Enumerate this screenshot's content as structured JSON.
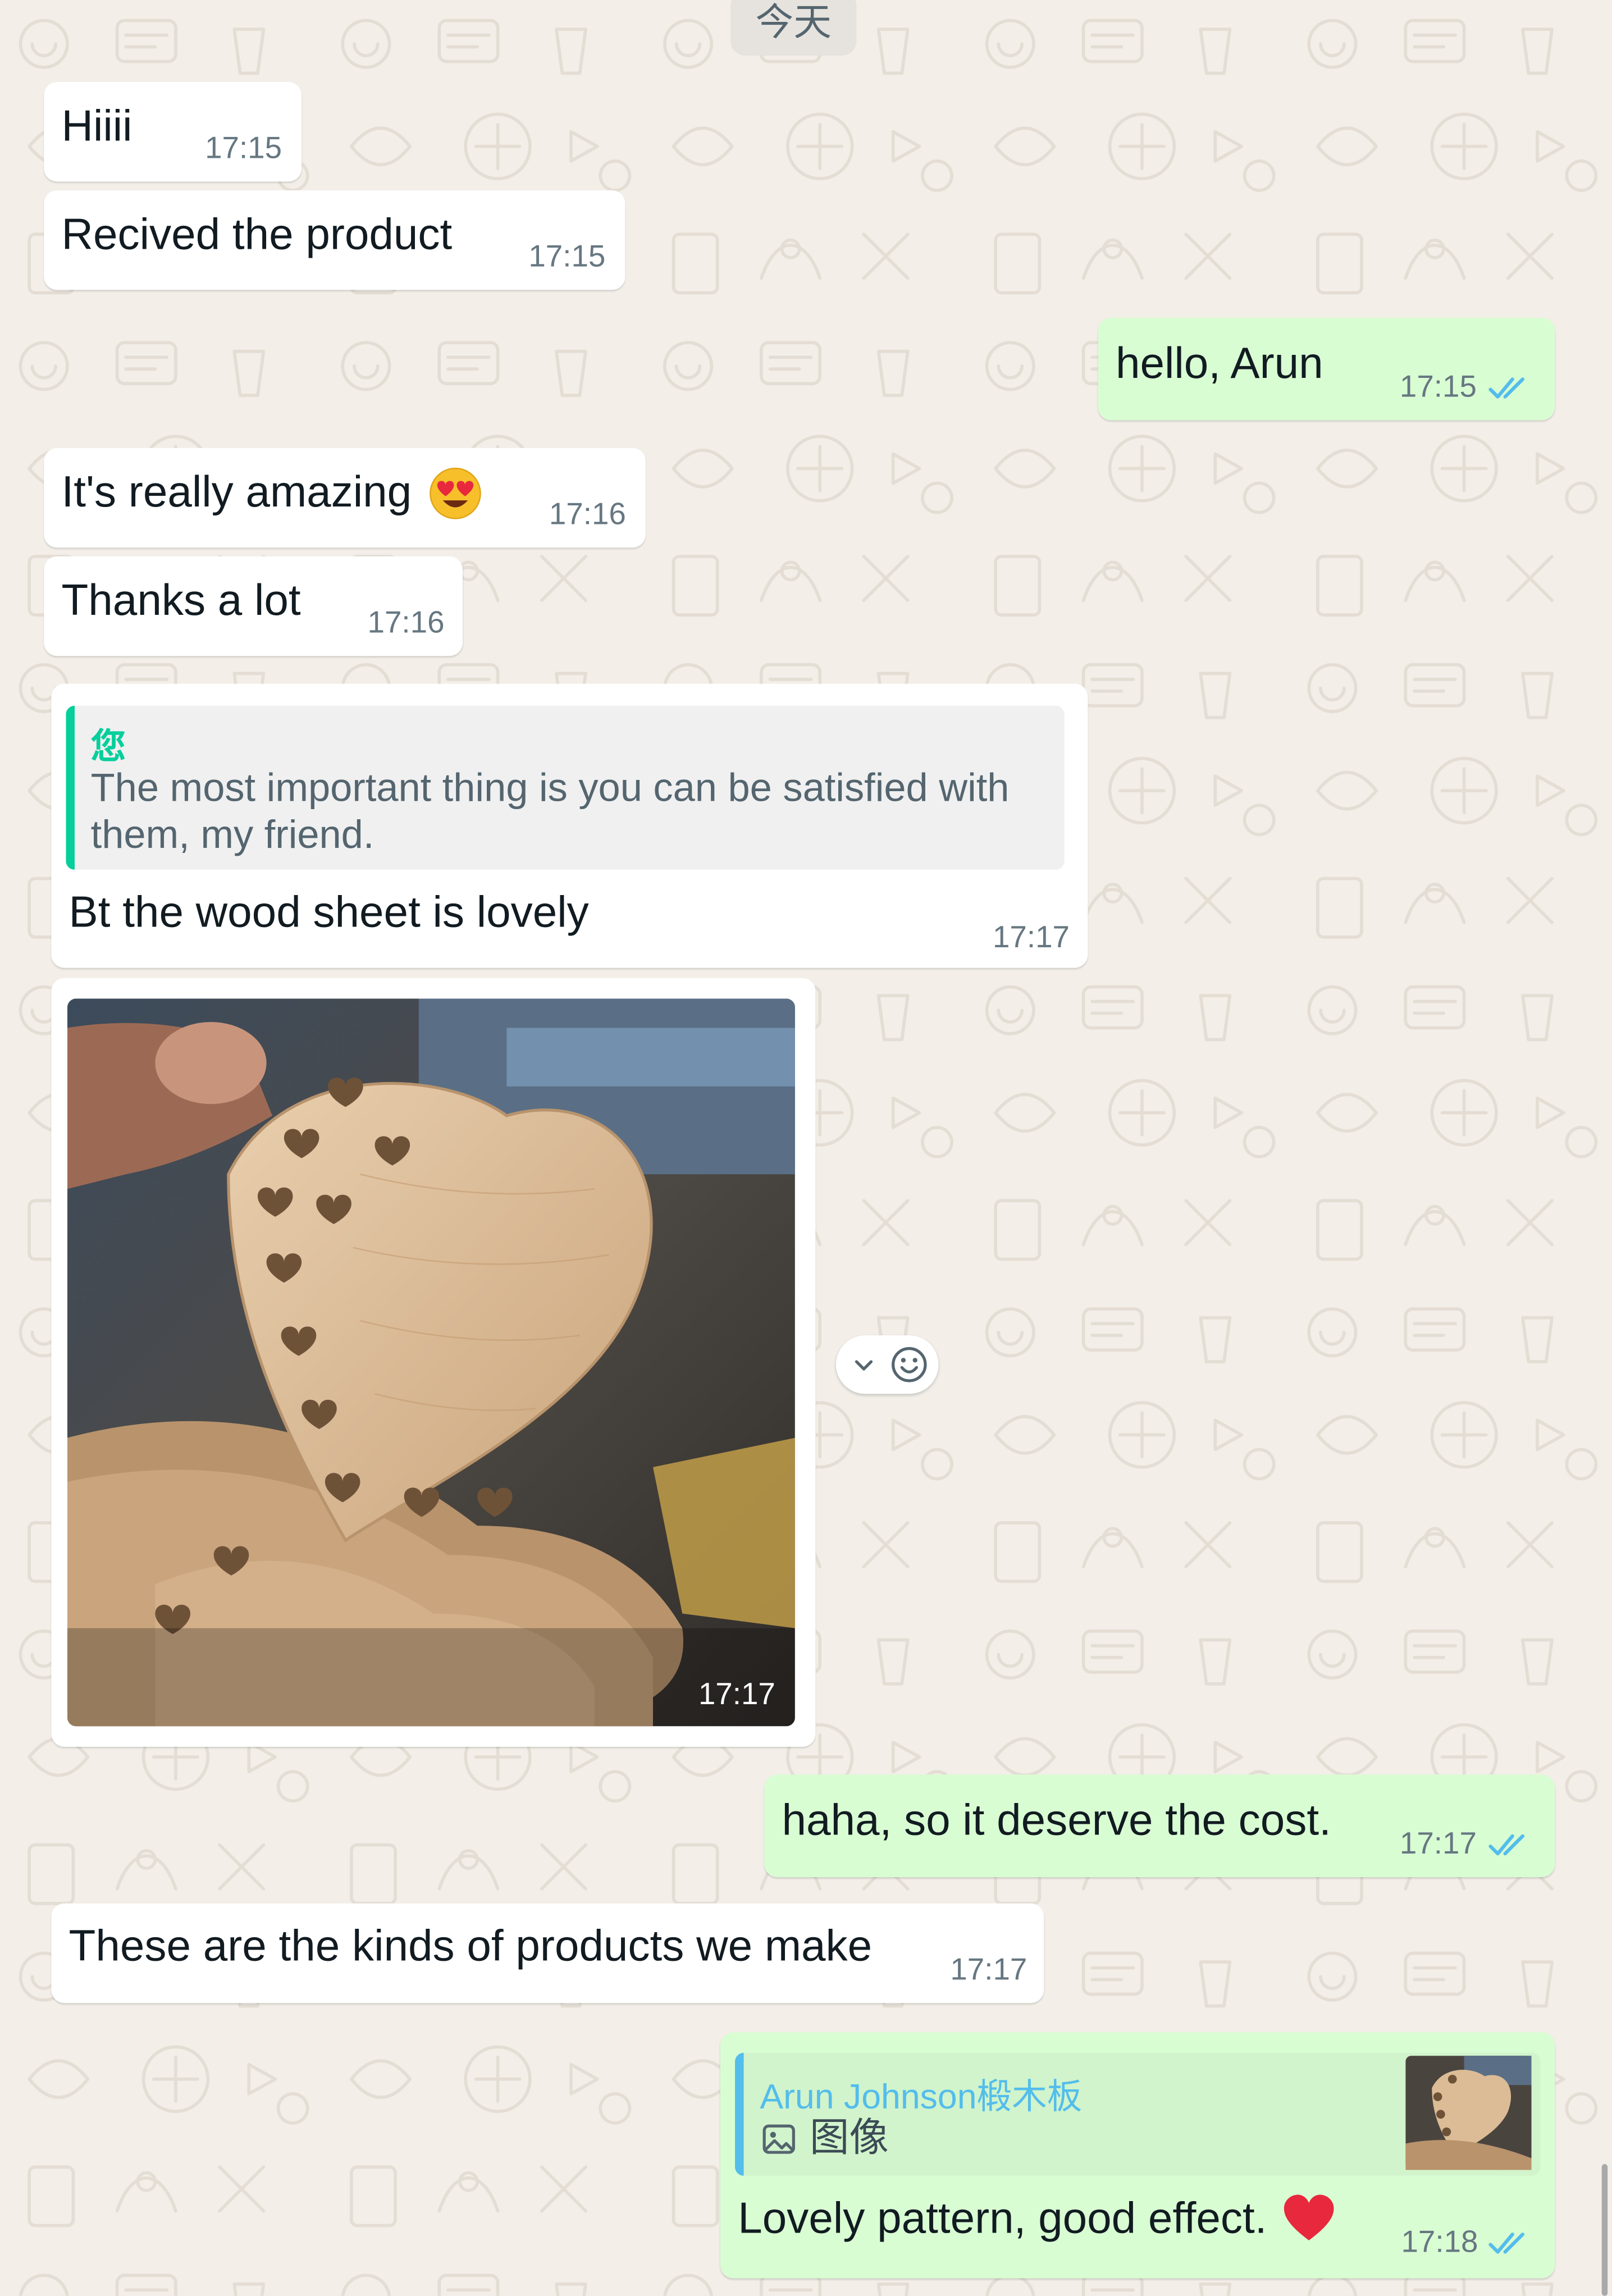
{
  "day_divider": "今天",
  "messages": [
    {
      "id": "m1",
      "direction": "incoming",
      "text": "Hiiii",
      "time": "17:15"
    },
    {
      "id": "m2",
      "direction": "incoming",
      "text": "Recived the product",
      "time": "17:15"
    },
    {
      "id": "m3",
      "direction": "outgoing",
      "text": "hello, Arun",
      "time": "17:15",
      "status": "read"
    },
    {
      "id": "m4",
      "direction": "incoming",
      "text": "It's really amazing",
      "emoji": "heart-eyes-emoji",
      "time": "17:16"
    },
    {
      "id": "m5",
      "direction": "incoming",
      "text": "Thanks a lot",
      "time": "17:16"
    },
    {
      "id": "m6",
      "direction": "incoming",
      "quote": {
        "author": "您",
        "lines": [
          "The most important thing is you can be satisfied with",
          "them, my friend."
        ]
      },
      "text": "Bt the wood sheet is lovely",
      "time": "17:17"
    },
    {
      "id": "m7",
      "direction": "incoming",
      "type": "image",
      "image": "photo-of-laser-cut-wooden-hearts",
      "time": "17:17"
    },
    {
      "id": "m8",
      "direction": "outgoing",
      "text": "haha, so it deserve the cost.",
      "time": "17:17",
      "status": "read"
    },
    {
      "id": "m9",
      "direction": "incoming",
      "text": "These are the kinds of products we make",
      "time": "17:17"
    },
    {
      "id": "m10",
      "direction": "outgoing",
      "quote": {
        "author": "Arun Johnson椴木板",
        "label": "图像",
        "icon": "image-icon",
        "thumbnail": "wooden-heart-thumbnail"
      },
      "text": "Lovely pattern, good effect.",
      "emoji": "red-heart-emoji",
      "time": "17:18",
      "status": "read"
    }
  ],
  "hover_actions": {
    "icons": [
      "chevron-down-icon",
      "emoji-reaction-icon"
    ]
  },
  "colors": {
    "wallpaper": "#f3eee8",
    "incoming_bubble": "#ffffff",
    "outgoing_bubble": "#d9fdd3",
    "read_ticks": "#53bdeb",
    "quote_bar_self": "#06cf9c",
    "quote_bar_contact": "#53bdeb",
    "timestamp": "#667781"
  }
}
